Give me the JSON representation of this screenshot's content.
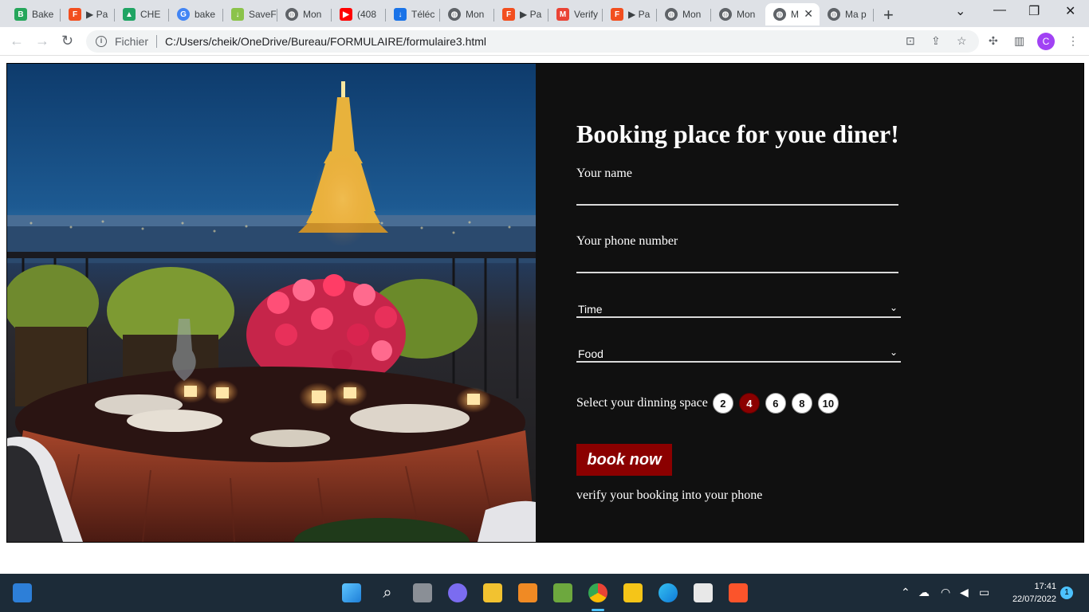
{
  "browser": {
    "tabs": [
      {
        "label": "Bake",
        "icon": "bakeo-icon",
        "color": "#26a65b"
      },
      {
        "label": "▶ Pa",
        "icon": "figma-icon",
        "color": "#f24e1e"
      },
      {
        "label": "CHE",
        "icon": "google-drive-icon",
        "color": "#1fa463"
      },
      {
        "label": "bake",
        "icon": "google-app-icon",
        "color": "#4285f4"
      },
      {
        "label": "SaveF",
        "icon": "savefrom-icon",
        "color": "#8bc34a"
      },
      {
        "label": "Mon",
        "icon": "globe-icon",
        "color": "#5f6368"
      },
      {
        "label": "(408",
        "icon": "youtube-icon",
        "color": "#ff0000"
      },
      {
        "label": "Téléc",
        "icon": "download-icon",
        "color": "#1a73e8"
      },
      {
        "label": "Mon",
        "icon": "globe-icon",
        "color": "#5f6368"
      },
      {
        "label": "▶ Pa",
        "icon": "figma-icon",
        "color": "#f24e1e"
      },
      {
        "label": "Verify",
        "icon": "gmail-icon",
        "color": "#ea4335"
      },
      {
        "label": "▶ Pa",
        "icon": "figma-icon",
        "color": "#f24e1e"
      },
      {
        "label": "Mon",
        "icon": "globe-icon",
        "color": "#5f6368"
      },
      {
        "label": "Mon",
        "icon": "globe-icon",
        "color": "#5f6368"
      },
      {
        "label": "M",
        "icon": "globe-icon",
        "color": "#5f6368",
        "active": true
      },
      {
        "label": "Ma p",
        "icon": "globe-icon",
        "color": "#5f6368"
      }
    ],
    "address": {
      "scheme": "Fichier",
      "url": "C:/Users/cheik/OneDrive/Bureau/FORMULAIRE/formulaire3.html"
    },
    "profile_initial": "C"
  },
  "booking": {
    "title": "Booking place for youe diner!",
    "name_label": "Your name",
    "phone_label": "Your phone number",
    "time_select": "Time",
    "food_select": "Food",
    "space_label": "Select your dinning space",
    "spaces": [
      "2",
      "4",
      "6",
      "8",
      "10"
    ],
    "selected_space": "4",
    "button_label": "book now",
    "note": "verify your booking into your phone",
    "accent_color": "#8b0000"
  },
  "taskbar": {
    "time": "17:41",
    "date": "22/07/2022",
    "notification_count": "1"
  }
}
